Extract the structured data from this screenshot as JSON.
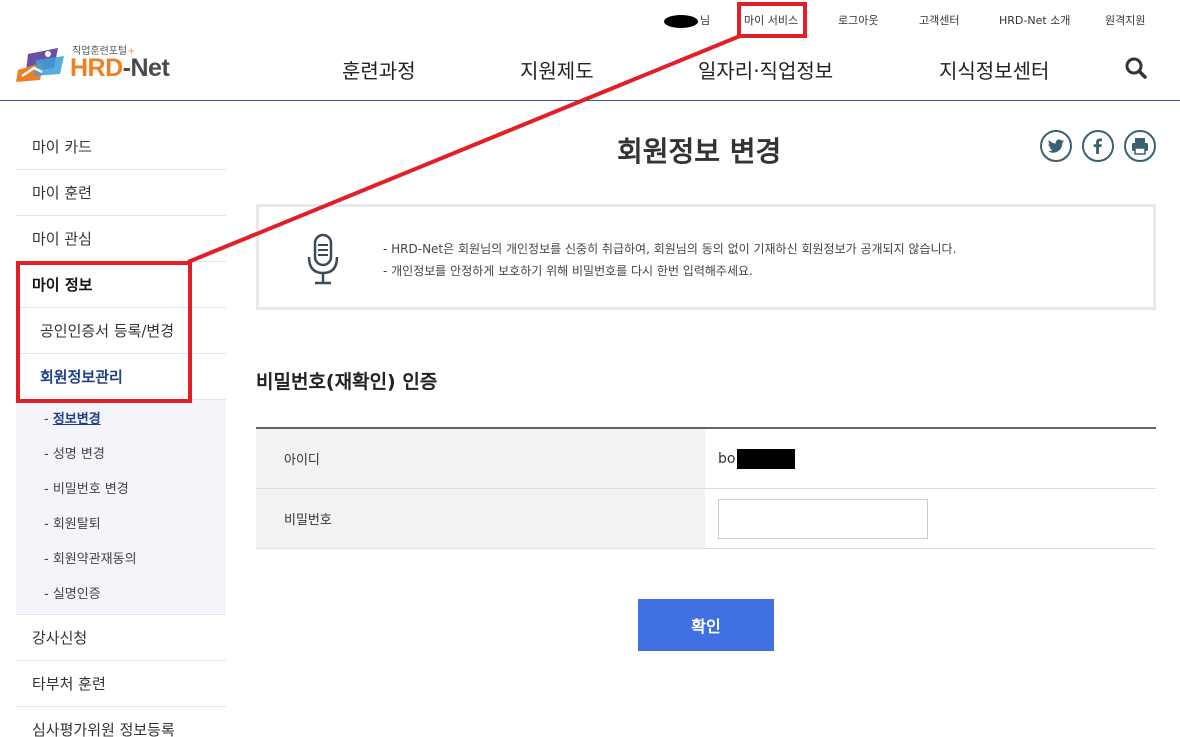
{
  "header": {
    "user_suffix": "님",
    "util_links": {
      "my_service": "마이 서비스",
      "logout": "로그아웃",
      "customer_center": "고객센터",
      "about": "HRD-Net 소개",
      "remote_support": "원격지원"
    },
    "logo": {
      "tagline": "직업훈련포털",
      "tagline_mark": "+",
      "brand_hrd": "HRD",
      "brand_net": "-Net"
    },
    "gnb": [
      "훈련과정",
      "지원제도",
      "일자리·직업정보",
      "지식정보센터"
    ],
    "search_icon": "search-icon"
  },
  "sidebar": {
    "items_top": [
      "마이 카드",
      "마이 훈련",
      "마이 관심"
    ],
    "active_item": "마이 정보",
    "sub_items": [
      "공인인증서 등록/변경",
      "회원정보관리"
    ],
    "deep_items": [
      "정보변경",
      "성명 변경",
      "비밀번호 변경",
      "회원탈퇴",
      "회원약관재동의",
      "실명인증"
    ],
    "deep_prefix": "- ",
    "items_bottom": [
      "강사신청",
      "타부처 훈련",
      "심사평가위원 정보등록"
    ]
  },
  "main": {
    "title": "회원정보 변경",
    "share_icons": [
      "twitter-icon",
      "facebook-icon",
      "print-icon"
    ],
    "notice": {
      "line1": "- HRD-Net은 회원님의 개인정보를 신중히 취급하여, 회원님의 동의 없이 기재하신 회원정보가 공개되지 않습니다.",
      "line2": "- 개인정보를 안정하게 보호하기 위해 비밀번호를 다시 한번 입력해주세요."
    },
    "section_title": "비밀번호(재확인) 인증",
    "table": {
      "id_label": "아이디",
      "id_value_prefix": "bo",
      "password_label": "비밀번호",
      "password_value": ""
    },
    "confirm_label": "확인"
  },
  "colors": {
    "annotation_red": "#e01f26",
    "button_blue": "#3f6fe0",
    "header_line": "#3b5998",
    "brand_orange": "#f07f23",
    "active_blue": "#1f3f8a"
  }
}
